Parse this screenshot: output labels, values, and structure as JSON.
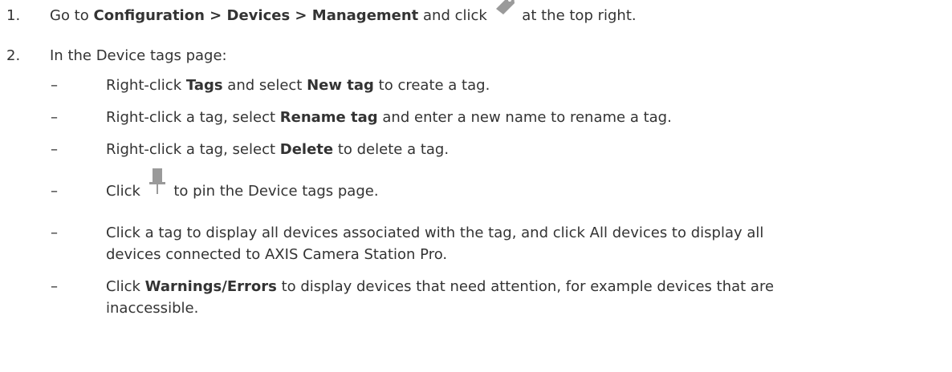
{
  "step1": {
    "number": "1.",
    "t1": "Go to",
    "path": "Configuration > Devices > Management",
    "t2": "and click",
    "t3": "at the top right.",
    "icon": "tag-icon"
  },
  "step2": {
    "number": "2.",
    "intro": "In the Device tags page:",
    "dash": "–",
    "b1": {
      "t1": "Right-click",
      "bold1": "Tags",
      "t2": "and select",
      "bold2": "New tag",
      "t3": "to create a tag."
    },
    "b2": {
      "t1": "Right-click a tag, select",
      "bold1": "Rename tag",
      "t2": "and enter a new name to rename a tag."
    },
    "b3": {
      "t1": "Right-click a tag, select",
      "bold1": "Delete",
      "t2": "to delete a tag."
    },
    "b4": {
      "t1": "Click",
      "t2": "to pin the Device tags page.",
      "icon": "pin-icon"
    },
    "b5": {
      "line1": "Click a tag to display all devices associated with the tag, and click All devices to display all",
      "line2": "devices connected to AXIS Camera Station Pro."
    },
    "b6": {
      "t1": "Click",
      "bold1": "Warnings/Errors",
      "t2": "to display devices that need attention, for example devices that are",
      "line2": "inaccessible."
    }
  },
  "colors": {
    "text": "#333333",
    "icon": "#9a9a9a"
  }
}
